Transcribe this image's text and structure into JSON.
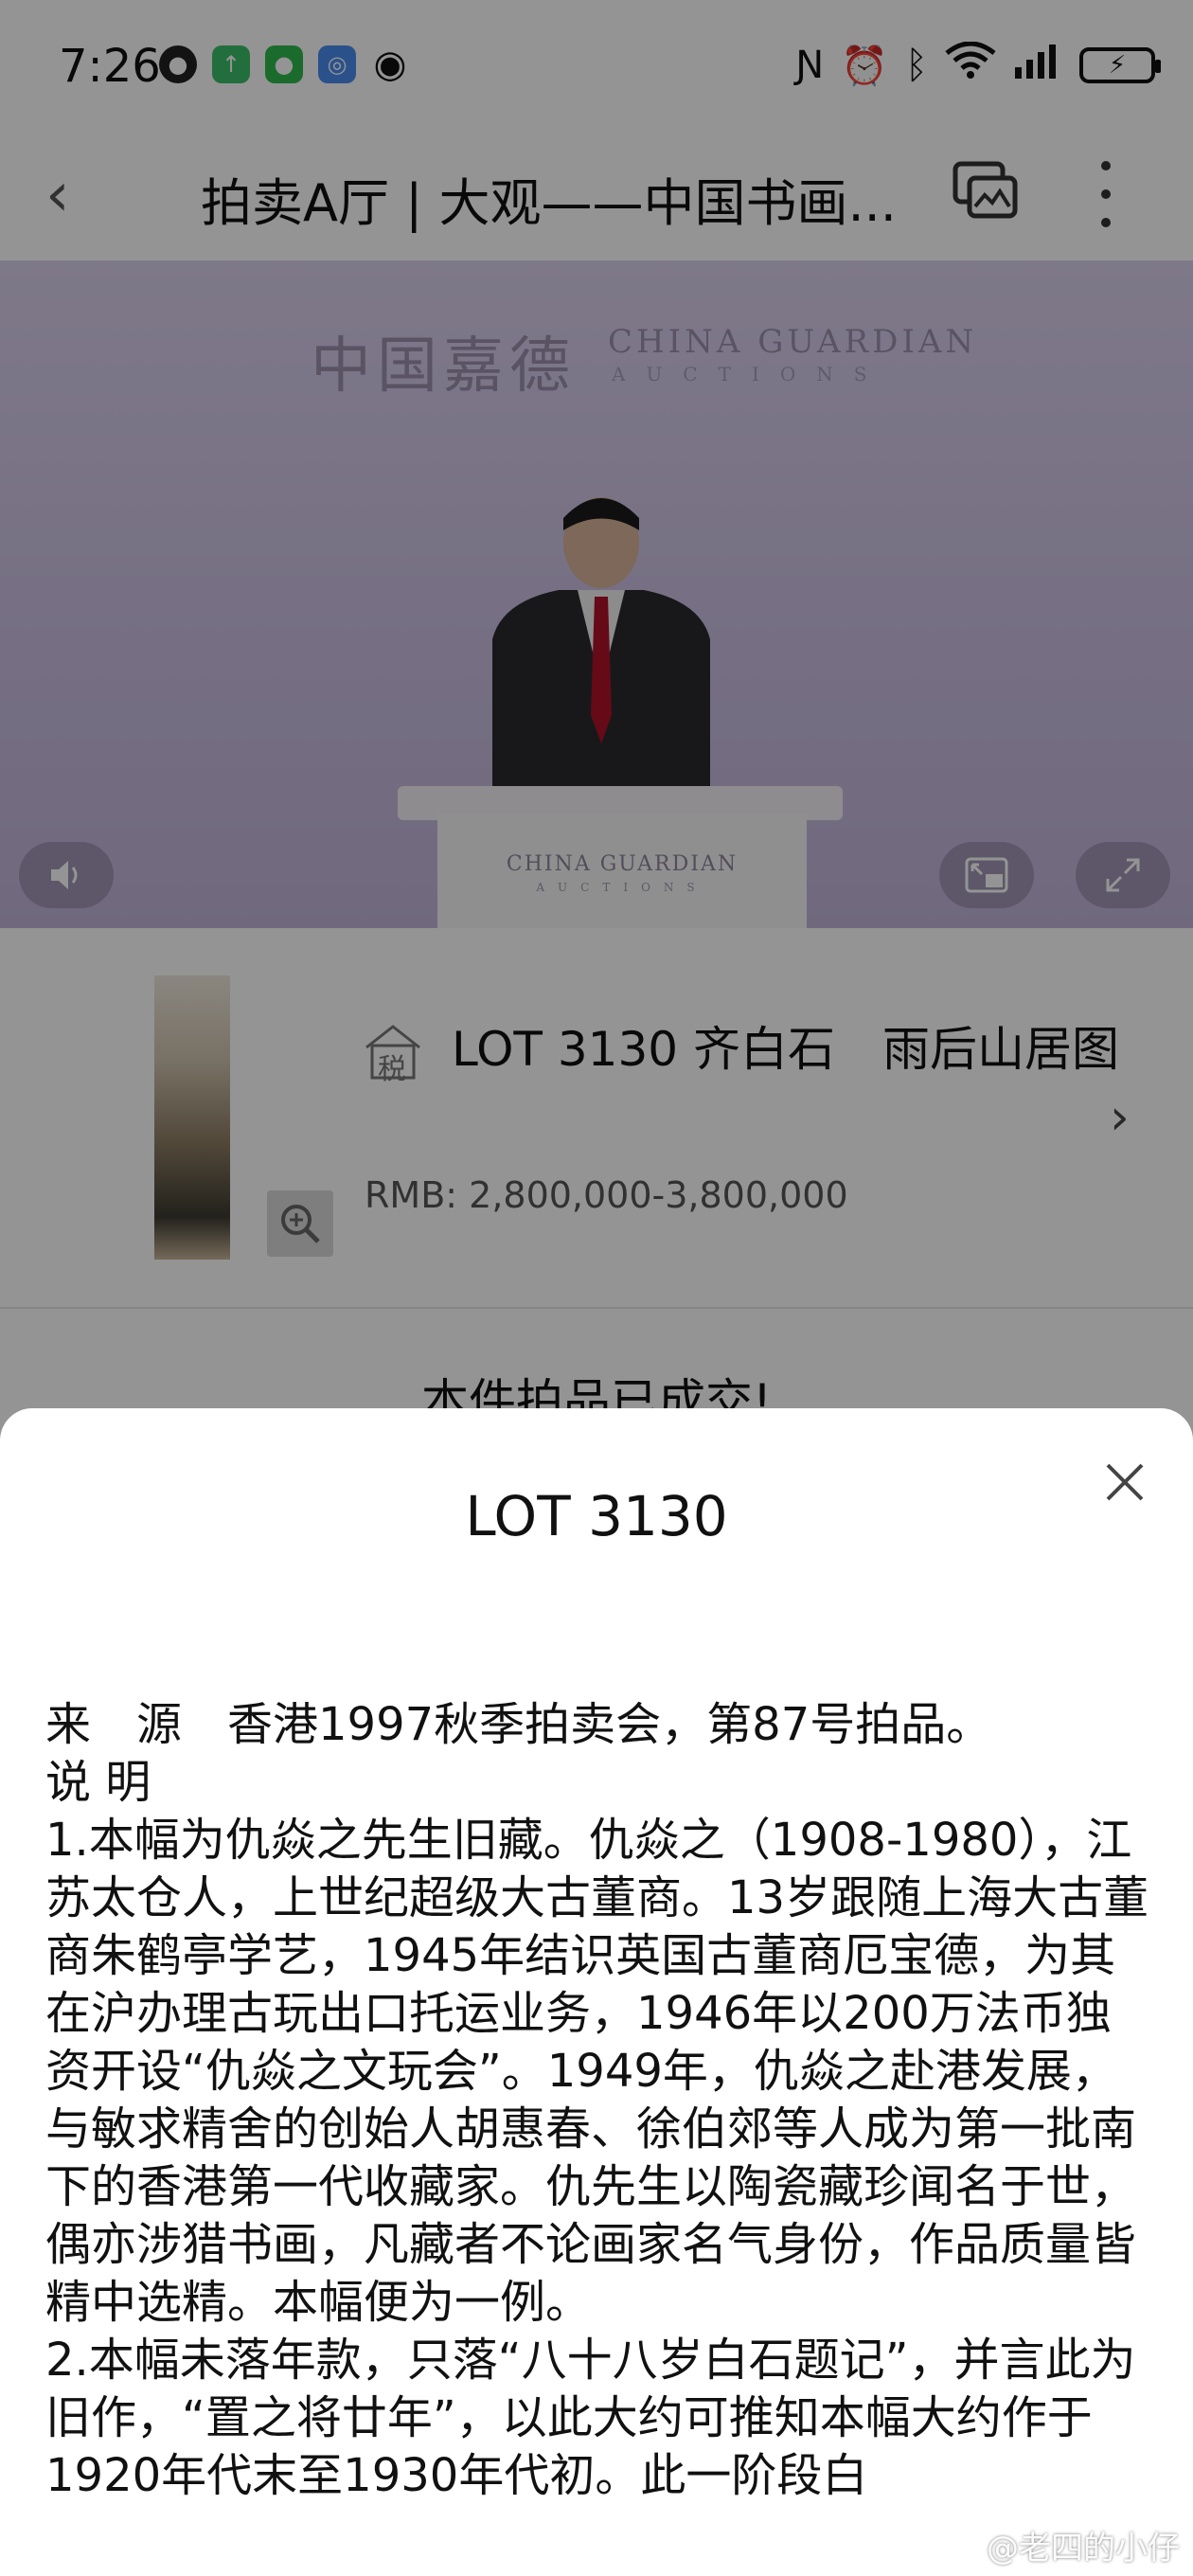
{
  "status_bar": {
    "time": "7:26",
    "icons": [
      "nfc-icon",
      "alarm-icon",
      "bluetooth-icon",
      "wifi-icon",
      "signal-icon",
      "battery-charging-icon"
    ]
  },
  "nav": {
    "back_icon": "chevron-left-icon",
    "title": "拍卖A厅 | 大观——中国书画...",
    "cast_icon": "cast-icon",
    "more_icon": "more-vertical-icon"
  },
  "video": {
    "logo_cn": "中国嘉德",
    "logo_en": "CHINA GUARDIAN",
    "logo_en_sub": "AUCTIONS",
    "podium_text": "CHINA GUARDIAN",
    "podium_sub": "AUCTIONS",
    "controls": [
      "volume-icon",
      "picture-in-picture-icon",
      "fullscreen-icon"
    ]
  },
  "lot": {
    "tax_badge": "税",
    "title": "LOT 3130 齐白石　雨后山居图",
    "price": "RMB: 2,800,000-3,800,000",
    "zoom_icon": "zoom-in-icon",
    "chevron_icon": "chevron-right-icon"
  },
  "sold_text": "本件拍品已成交!",
  "sheet": {
    "title": "LOT 3130",
    "close_icon": "close-icon",
    "paragraphs": [
      "来　源　香港1997秋季拍卖会，第87号拍品。",
      "说 明",
      "1.本幅为仇焱之先生旧藏。仇焱之（1908-1980），江苏太仓人，上世纪超级大古董商。13岁跟随上海大古董商朱鹤亭学艺，1945年结识英国古董商厄宝德，为其在沪办理古玩出口托运业务，1946年以200万法币独资开设“仇焱之文玩会”。1949年，仇焱之赴港发展，与敏求精舍的创始人胡惠春、徐伯郊等人成为第一批南下的香港第一代收藏家。仇先生以陶瓷藏珍闻名于世，偶亦涉猎书画，凡藏者不论画家名气身份，作品质量皆精中选精。本幅便为一例。",
      "2.本幅未落年款，只落“八十八岁白石题记”，并言此为旧作，“置之将廿年”，以此大约可推知本幅大约作于1920年代末至1930年代初。此一阶段白"
    ]
  },
  "watermark": "@老四的小仔",
  "colors": {
    "video_bg": "#cbbfe2",
    "dim_overlay": "rgba(0,0,0,0.42)",
    "sheet_bg": "#ffffff",
    "text": "#111111"
  }
}
